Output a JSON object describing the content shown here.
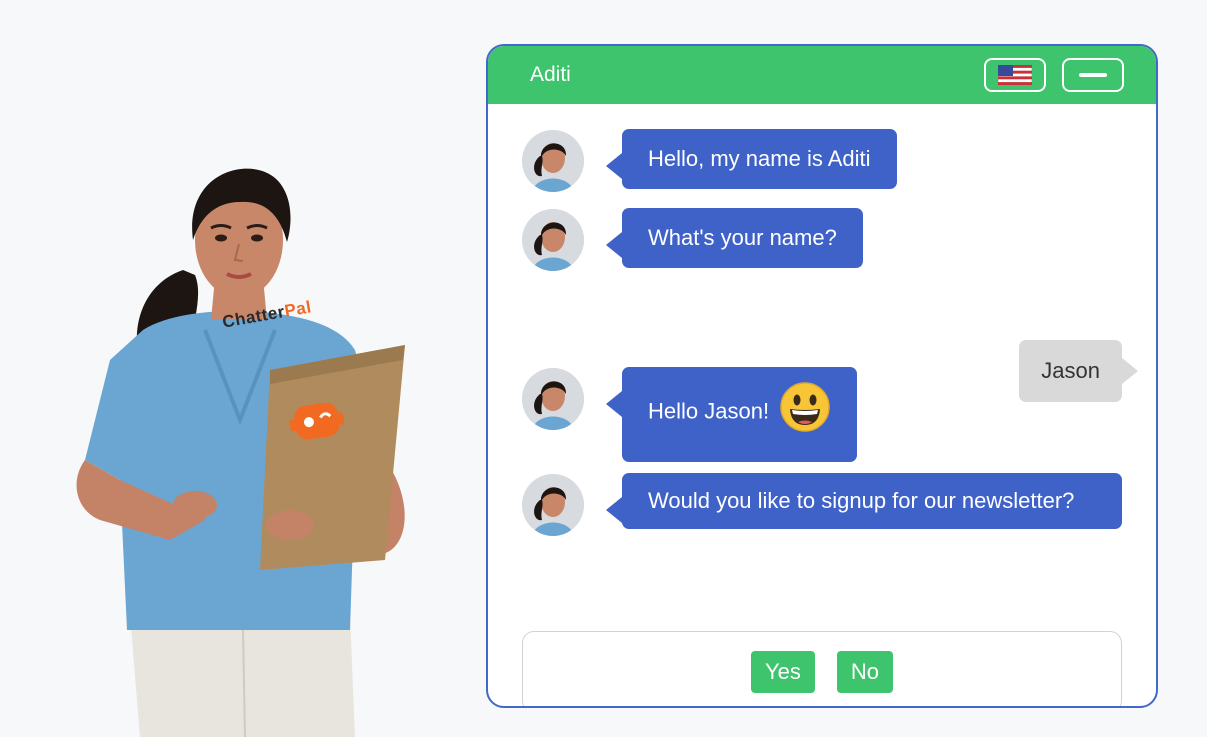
{
  "brand": {
    "part1": "Chatter",
    "part2": "Pal"
  },
  "chat": {
    "title": "Aditi",
    "header_buttons": [
      {
        "icon": "us-flag-icon",
        "purpose": "language"
      },
      {
        "icon": "minimize-icon",
        "purpose": "minimize"
      }
    ],
    "messages": [
      {
        "from": "bot",
        "text": "Hello, my name is Aditi"
      },
      {
        "from": "bot",
        "text": "What's your name?"
      },
      {
        "from": "user",
        "text": "Jason"
      },
      {
        "from": "bot",
        "text": "Hello Jason!",
        "emoji": "grinning-face-emoji"
      },
      {
        "from": "bot",
        "text": "Would you like to signup for our newsletter?"
      }
    ],
    "choices": [
      {
        "label": "Yes"
      },
      {
        "label": "No"
      }
    ]
  },
  "colors": {
    "header_green": "#3ec46d",
    "bot_bubble_blue": "#3f62c8",
    "user_bubble_gray": "#d9d9d9",
    "widget_border": "#4169c8",
    "brand_orange": "#f26a22"
  }
}
